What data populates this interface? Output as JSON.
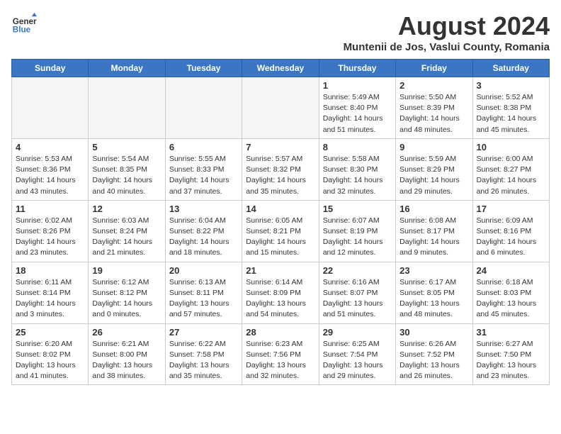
{
  "header": {
    "logo_line1": "General",
    "logo_line2": "Blue",
    "month_title": "August 2024",
    "subtitle": "Muntenii de Jos, Vaslui County, Romania"
  },
  "weekdays": [
    "Sunday",
    "Monday",
    "Tuesday",
    "Wednesday",
    "Thursday",
    "Friday",
    "Saturday"
  ],
  "weeks": [
    [
      {
        "day": "",
        "info": ""
      },
      {
        "day": "",
        "info": ""
      },
      {
        "day": "",
        "info": ""
      },
      {
        "day": "",
        "info": ""
      },
      {
        "day": "1",
        "info": "Sunrise: 5:49 AM\nSunset: 8:40 PM\nDaylight: 14 hours and 51 minutes."
      },
      {
        "day": "2",
        "info": "Sunrise: 5:50 AM\nSunset: 8:39 PM\nDaylight: 14 hours and 48 minutes."
      },
      {
        "day": "3",
        "info": "Sunrise: 5:52 AM\nSunset: 8:38 PM\nDaylight: 14 hours and 45 minutes."
      }
    ],
    [
      {
        "day": "4",
        "info": "Sunrise: 5:53 AM\nSunset: 8:36 PM\nDaylight: 14 hours and 43 minutes."
      },
      {
        "day": "5",
        "info": "Sunrise: 5:54 AM\nSunset: 8:35 PM\nDaylight: 14 hours and 40 minutes."
      },
      {
        "day": "6",
        "info": "Sunrise: 5:55 AM\nSunset: 8:33 PM\nDaylight: 14 hours and 37 minutes."
      },
      {
        "day": "7",
        "info": "Sunrise: 5:57 AM\nSunset: 8:32 PM\nDaylight: 14 hours and 35 minutes."
      },
      {
        "day": "8",
        "info": "Sunrise: 5:58 AM\nSunset: 8:30 PM\nDaylight: 14 hours and 32 minutes."
      },
      {
        "day": "9",
        "info": "Sunrise: 5:59 AM\nSunset: 8:29 PM\nDaylight: 14 hours and 29 minutes."
      },
      {
        "day": "10",
        "info": "Sunrise: 6:00 AM\nSunset: 8:27 PM\nDaylight: 14 hours and 26 minutes."
      }
    ],
    [
      {
        "day": "11",
        "info": "Sunrise: 6:02 AM\nSunset: 8:26 PM\nDaylight: 14 hours and 23 minutes."
      },
      {
        "day": "12",
        "info": "Sunrise: 6:03 AM\nSunset: 8:24 PM\nDaylight: 14 hours and 21 minutes."
      },
      {
        "day": "13",
        "info": "Sunrise: 6:04 AM\nSunset: 8:22 PM\nDaylight: 14 hours and 18 minutes."
      },
      {
        "day": "14",
        "info": "Sunrise: 6:05 AM\nSunset: 8:21 PM\nDaylight: 14 hours and 15 minutes."
      },
      {
        "day": "15",
        "info": "Sunrise: 6:07 AM\nSunset: 8:19 PM\nDaylight: 14 hours and 12 minutes."
      },
      {
        "day": "16",
        "info": "Sunrise: 6:08 AM\nSunset: 8:17 PM\nDaylight: 14 hours and 9 minutes."
      },
      {
        "day": "17",
        "info": "Sunrise: 6:09 AM\nSunset: 8:16 PM\nDaylight: 14 hours and 6 minutes."
      }
    ],
    [
      {
        "day": "18",
        "info": "Sunrise: 6:11 AM\nSunset: 8:14 PM\nDaylight: 14 hours and 3 minutes."
      },
      {
        "day": "19",
        "info": "Sunrise: 6:12 AM\nSunset: 8:12 PM\nDaylight: 14 hours and 0 minutes."
      },
      {
        "day": "20",
        "info": "Sunrise: 6:13 AM\nSunset: 8:11 PM\nDaylight: 13 hours and 57 minutes."
      },
      {
        "day": "21",
        "info": "Sunrise: 6:14 AM\nSunset: 8:09 PM\nDaylight: 13 hours and 54 minutes."
      },
      {
        "day": "22",
        "info": "Sunrise: 6:16 AM\nSunset: 8:07 PM\nDaylight: 13 hours and 51 minutes."
      },
      {
        "day": "23",
        "info": "Sunrise: 6:17 AM\nSunset: 8:05 PM\nDaylight: 13 hours and 48 minutes."
      },
      {
        "day": "24",
        "info": "Sunrise: 6:18 AM\nSunset: 8:03 PM\nDaylight: 13 hours and 45 minutes."
      }
    ],
    [
      {
        "day": "25",
        "info": "Sunrise: 6:20 AM\nSunset: 8:02 PM\nDaylight: 13 hours and 41 minutes."
      },
      {
        "day": "26",
        "info": "Sunrise: 6:21 AM\nSunset: 8:00 PM\nDaylight: 13 hours and 38 minutes."
      },
      {
        "day": "27",
        "info": "Sunrise: 6:22 AM\nSunset: 7:58 PM\nDaylight: 13 hours and 35 minutes."
      },
      {
        "day": "28",
        "info": "Sunrise: 6:23 AM\nSunset: 7:56 PM\nDaylight: 13 hours and 32 minutes."
      },
      {
        "day": "29",
        "info": "Sunrise: 6:25 AM\nSunset: 7:54 PM\nDaylight: 13 hours and 29 minutes."
      },
      {
        "day": "30",
        "info": "Sunrise: 6:26 AM\nSunset: 7:52 PM\nDaylight: 13 hours and 26 minutes."
      },
      {
        "day": "31",
        "info": "Sunrise: 6:27 AM\nSunset: 7:50 PM\nDaylight: 13 hours and 23 minutes."
      }
    ]
  ]
}
